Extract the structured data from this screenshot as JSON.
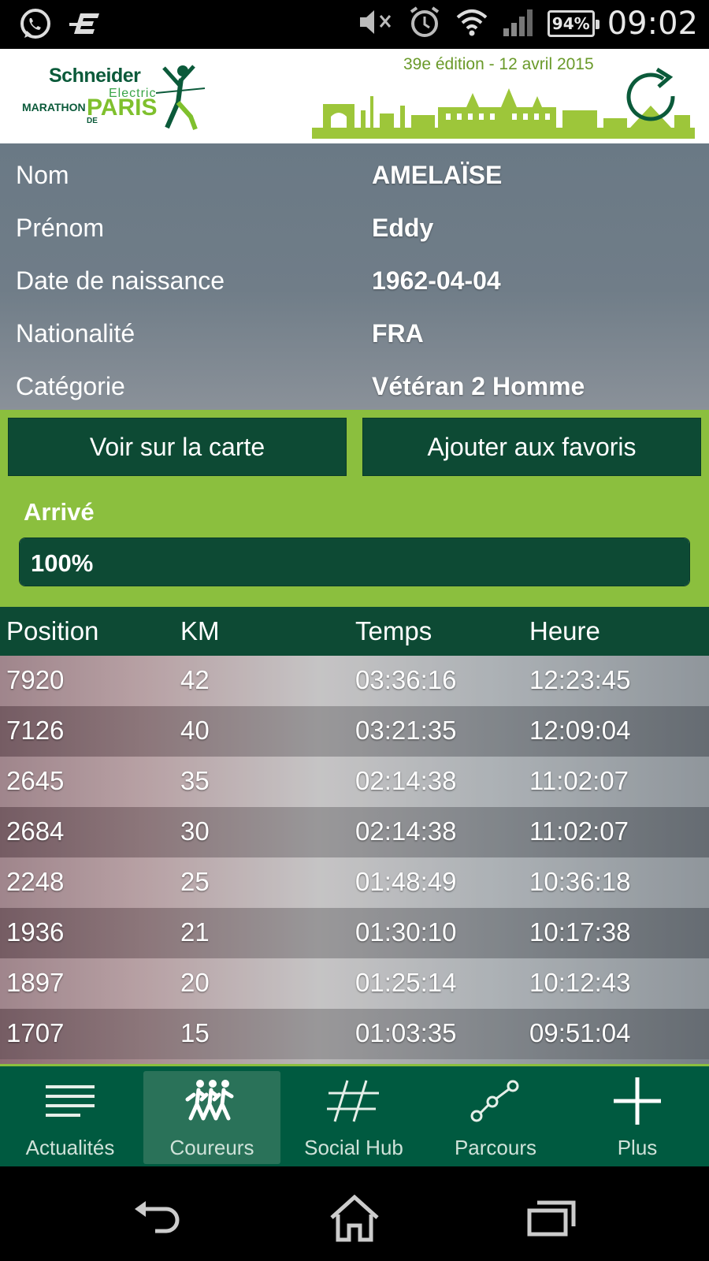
{
  "status_bar": {
    "time": "09:02",
    "battery": "94%",
    "icons": [
      "whatsapp-icon",
      "sync-e-icon",
      "mute-icon",
      "alarm-icon",
      "wifi-icon",
      "signal-icon",
      "battery-icon"
    ]
  },
  "header": {
    "logo": {
      "line1": "Schneider",
      "line2": "Electric",
      "line3": "MARATHON",
      "line4": "PARIS",
      "line5": "DE"
    },
    "edition": "39e édition - 12 avril 2015",
    "refresh_icon": "refresh-icon"
  },
  "runner": {
    "fields": [
      {
        "label": "Nom",
        "value": "AMELAÏSE"
      },
      {
        "label": "Prénom",
        "value": "Eddy"
      },
      {
        "label": "Date de naissance",
        "value": "1962-04-04"
      },
      {
        "label": "Nationalité",
        "value": "FRA"
      },
      {
        "label": "Catégorie",
        "value": "Vétéran 2 Homme"
      }
    ]
  },
  "actions": {
    "map_label": "Voir sur la carte",
    "favorite_label": "Ajouter aux favoris"
  },
  "progress": {
    "status": "Arrivé",
    "percent_text": "100%",
    "fraction": 1.0
  },
  "splits": {
    "columns": [
      "Position",
      "KM",
      "Temps",
      "Heure"
    ],
    "rows": [
      [
        "7920",
        "42",
        "03:36:16",
        "12:23:45"
      ],
      [
        "7126",
        "40",
        "03:21:35",
        "12:09:04"
      ],
      [
        "2645",
        "35",
        "02:14:38",
        "11:02:07"
      ],
      [
        "2684",
        "30",
        "02:14:38",
        "11:02:07"
      ],
      [
        "2248",
        "25",
        "01:48:49",
        "10:36:18"
      ],
      [
        "1936",
        "21",
        "01:30:10",
        "10:17:38"
      ],
      [
        "1897",
        "20",
        "01:25:14",
        "10:12:43"
      ],
      [
        "1707",
        "15",
        "01:03:35",
        "09:51:04"
      ]
    ]
  },
  "bottom_nav": {
    "items": [
      {
        "label": "Actualités",
        "icon": "news-lines-icon"
      },
      {
        "label": "Coureurs",
        "icon": "runners-icon",
        "active": true
      },
      {
        "label": "Social Hub",
        "icon": "hashtag-icon"
      },
      {
        "label": "Parcours",
        "icon": "route-icon"
      },
      {
        "label": "Plus",
        "icon": "plus-icon"
      }
    ]
  },
  "system_nav": [
    "back-icon",
    "home-icon",
    "recent-apps-icon"
  ],
  "colors": {
    "dark_green": "#0d4a34",
    "lime": "#8bbf3e",
    "nav_green": "#005a40"
  }
}
